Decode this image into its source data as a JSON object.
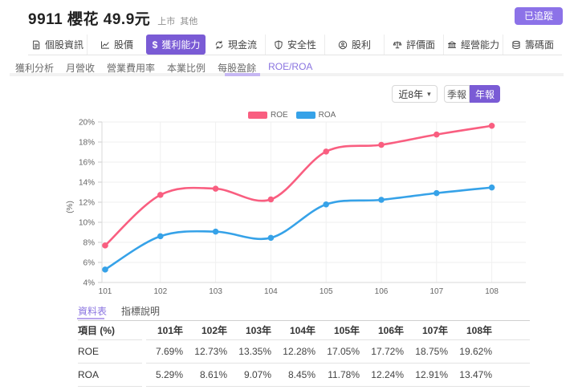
{
  "header": {
    "title": "9911 櫻花 49.9元",
    "market": "上市",
    "industry": "其他",
    "follow_label": "已追蹤"
  },
  "icons": {
    "chevron_down": "▾",
    "dollar_char": "$"
  },
  "colors": {
    "accent_purple": "#7a5bd5",
    "light_purple": "#8c72e8",
    "subnav_active_purple": "#8a74e0",
    "roe_pink": "#f95e80",
    "roa_blue": "#36a2e8"
  },
  "nav": {
    "items": [
      {
        "label": "個股資訊",
        "icon": "document-icon",
        "active": false
      },
      {
        "label": "股價",
        "icon": "stock-chart-icon",
        "active": false
      },
      {
        "label": "獲利能力",
        "icon": "dollar-icon",
        "active": true
      },
      {
        "label": "現金流",
        "icon": "cashflow-icon",
        "active": false
      },
      {
        "label": "安全性",
        "icon": "shield-icon",
        "active": false
      },
      {
        "label": "股利",
        "icon": "dividend-icon",
        "active": false
      },
      {
        "label": "評價面",
        "icon": "valuation-icon",
        "active": false
      },
      {
        "label": "經營能力",
        "icon": "management-icon",
        "active": false
      },
      {
        "label": "籌碼面",
        "icon": "chips-icon",
        "active": false
      }
    ]
  },
  "subnav": {
    "items": [
      {
        "label": "獲利分析",
        "active": false
      },
      {
        "label": "月營收",
        "active": false
      },
      {
        "label": "營業費用率",
        "active": false
      },
      {
        "label": "本業比例",
        "active": false
      },
      {
        "label": "每股盈餘",
        "active": false
      },
      {
        "label": "ROE/ROA",
        "active": true
      }
    ]
  },
  "controls": {
    "range_select_value": "近8年",
    "period_toggle": [
      {
        "label": "季報",
        "active": false
      },
      {
        "label": "年報",
        "active": true
      }
    ]
  },
  "chart_data": {
    "type": "line",
    "title": "",
    "x_categories": [
      "101",
      "102",
      "103",
      "104",
      "105",
      "106",
      "107",
      "108"
    ],
    "series": [
      {
        "name": "ROE",
        "color": "#f95e80",
        "values": [
          7.69,
          12.73,
          13.35,
          12.28,
          17.05,
          17.72,
          18.75,
          19.62
        ]
      },
      {
        "name": "ROA",
        "color": "#36a2e8",
        "values": [
          5.29,
          8.61,
          9.07,
          8.45,
          11.78,
          12.24,
          12.91,
          13.47
        ]
      }
    ],
    "ylabel": "(%)",
    "xlabel": "",
    "ylim": [
      4,
      20
    ],
    "ytick_step": 2,
    "ytick_suffix": "%",
    "grid": true,
    "legend_position": "top",
    "line_style": "spline"
  },
  "table": {
    "tabs": [
      {
        "label": "資料表",
        "active": true
      },
      {
        "label": "指標說明",
        "active": false
      }
    ],
    "header": [
      "項目 (%)",
      "101年",
      "102年",
      "103年",
      "104年",
      "105年",
      "106年",
      "107年",
      "108年"
    ],
    "rows": [
      {
        "label": "ROE",
        "values": [
          "7.69%",
          "12.73%",
          "13.35%",
          "12.28%",
          "17.05%",
          "17.72%",
          "18.75%",
          "19.62%"
        ]
      },
      {
        "label": "ROA",
        "values": [
          "5.29%",
          "8.61%",
          "9.07%",
          "8.45%",
          "11.78%",
          "12.24%",
          "12.91%",
          "13.47%"
        ]
      }
    ]
  }
}
